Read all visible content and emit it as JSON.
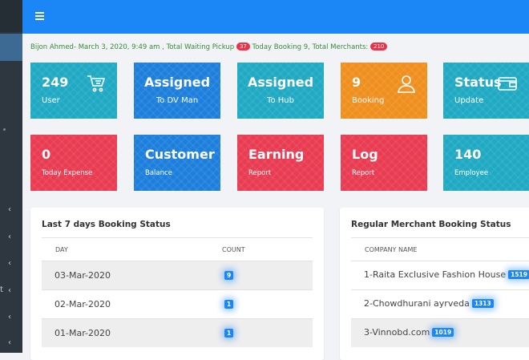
{
  "info": {
    "text": "Bijon Ahmed- March 3, 2020, 9:49 am , Total Waiting Pickup",
    "waiting_pickup": "37",
    "today_booking": "Today Booking 9, Total Merchants:",
    "total_merchants": "210"
  },
  "cards": {
    "users": {
      "big": "249",
      "small": "User",
      "icon": "cart-icon"
    },
    "dv_man": {
      "big": "Assigned",
      "small": "To DV Man"
    },
    "hub": {
      "big": "Assigned",
      "small": "To Hub"
    },
    "booking": {
      "big": "9",
      "small": "Booking",
      "icon": "user-icon"
    },
    "status": {
      "big": "Status",
      "small": "Update",
      "icon": "wallet-icon"
    },
    "expense": {
      "big": "0",
      "small": "Today Expense"
    },
    "customer": {
      "big": "Customer",
      "small": "Balance"
    },
    "earning": {
      "big": "Earning",
      "small": "Report"
    },
    "log": {
      "big": "Log",
      "small": "Report"
    },
    "employee": {
      "big": "140",
      "small": "Employee"
    }
  },
  "booking_panel": {
    "title": "Last 7 days Booking Status",
    "col_day": "DAY",
    "col_count": "COUNT",
    "rows": [
      {
        "day": "03-Mar-2020",
        "count": "9"
      },
      {
        "day": "02-Mar-2020",
        "count": "1"
      },
      {
        "day": "01-Mar-2020",
        "count": "1"
      }
    ]
  },
  "merchant_panel": {
    "title": "Regular Merchant Booking Status",
    "col_company": "COMPANY NAME",
    "rows": [
      {
        "name": "1-Raita Exclusive Fashion House",
        "count": "1519"
      },
      {
        "name": "2-Chowdhurani ayrveda",
        "count": "1313"
      },
      {
        "name": "3-Vinnobd.com",
        "count": "1019"
      }
    ]
  },
  "colors": {
    "topbar": "#1b87f7",
    "teal": "#1fa9c3",
    "blue": "#1d7fdc",
    "orange": "#ef8f1e",
    "red": "#e93b51",
    "sidebar": "#2e3740"
  }
}
